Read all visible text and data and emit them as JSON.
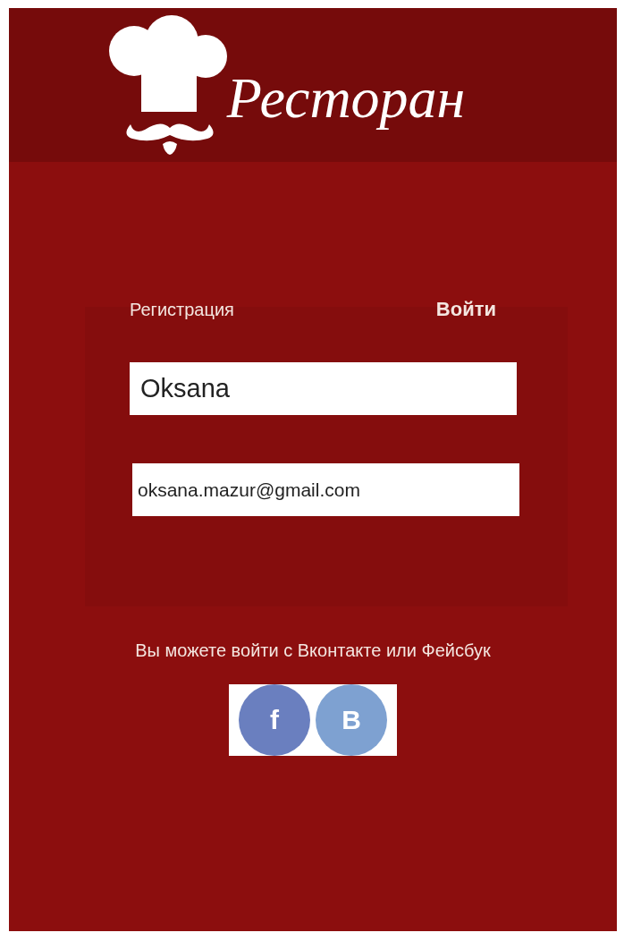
{
  "header": {
    "logo_text": "Ресторан"
  },
  "tabs": [
    {
      "label": "Регистрация",
      "selected": false
    },
    {
      "label": "Войти",
      "selected": true
    }
  ],
  "form": {
    "fields": [
      {
        "value": "Oksana",
        "kind": "name"
      },
      {
        "value": "oksana.mazur@gmail.com",
        "kind": "email"
      }
    ]
  },
  "social": {
    "text": "Вы можете войти с Вконтакте или Фейсбук",
    "buttons": [
      {
        "label": "f",
        "color": "#6a7fbf"
      },
      {
        "label": "B",
        "color": "#7ea1d1"
      }
    ]
  }
}
